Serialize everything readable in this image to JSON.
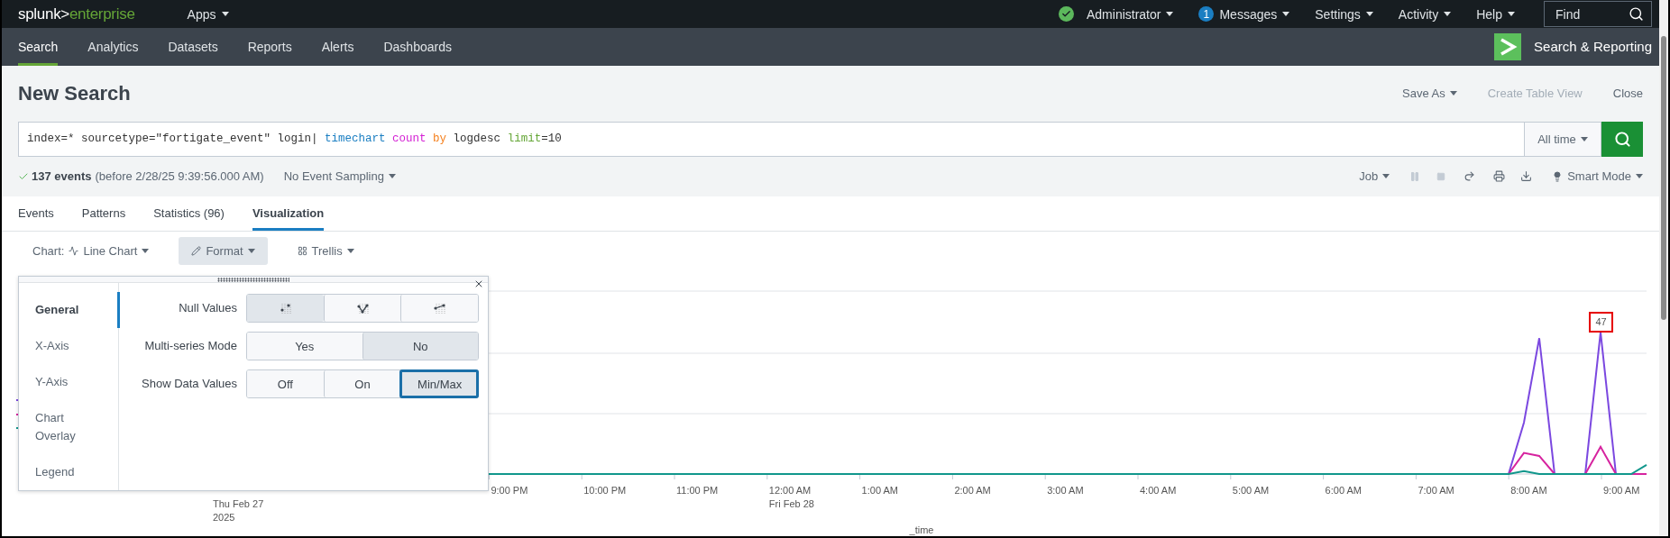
{
  "top_bar": {
    "logo_prefix": "splunk>",
    "logo_suffix": "enterprise",
    "apps_menu": "Apps",
    "user_menu": "Administrator",
    "messages": {
      "count": "1",
      "label": "Messages"
    },
    "menus": [
      "Settings",
      "Activity",
      "Help"
    ],
    "find": {
      "placeholder": "Find"
    }
  },
  "nav": {
    "tabs": [
      {
        "label": "Search",
        "selected": true
      },
      {
        "label": "Analytics",
        "selected": false
      },
      {
        "label": "Datasets",
        "selected": false
      },
      {
        "label": "Reports",
        "selected": false
      },
      {
        "label": "Alerts",
        "selected": false
      },
      {
        "label": "Dashboards",
        "selected": false
      }
    ],
    "app_title": "Search & Reporting"
  },
  "header": {
    "title": "New Search",
    "actions": [
      {
        "label": "Save As",
        "dropdown": true,
        "disabled": false
      },
      {
        "label": "Create Table View",
        "dropdown": false,
        "disabled": true
      },
      {
        "label": "Close",
        "dropdown": false,
        "disabled": false
      }
    ]
  },
  "search": {
    "query": [
      {
        "text": "index=* sourcetype=\"fortigate_event\" login| ",
        "kind": "plain"
      },
      {
        "text": "timechart ",
        "kind": "command"
      },
      {
        "text": "count ",
        "kind": "function"
      },
      {
        "text": "by",
        "kind": "keyword"
      },
      {
        "text": " logdesc ",
        "kind": "plain"
      },
      {
        "text": "limit",
        "kind": "argument"
      },
      {
        "text": "=10",
        "kind": "plain"
      }
    ],
    "time_range": "All time"
  },
  "status": {
    "count": "137 events",
    "detail": "(before 2/28/25 9:39:56.000 AM)",
    "sampling": "No Event Sampling",
    "job_menu": "Job",
    "mode": "Smart Mode"
  },
  "result_tabs": [
    {
      "label": "Events",
      "selected": false
    },
    {
      "label": "Patterns",
      "selected": false
    },
    {
      "label": "Statistics (96)",
      "selected": false
    },
    {
      "label": "Visualization",
      "selected": true
    }
  ],
  "viz_toolbar": {
    "chart_prefix": "Chart:",
    "chart_type": "Line Chart",
    "format": {
      "label": "Format",
      "active": true
    },
    "trellis": "Trellis"
  },
  "format_panel": {
    "sections": [
      {
        "label": "General",
        "selected": true
      },
      {
        "label": "X-Axis",
        "selected": false
      },
      {
        "label": "Y-Axis",
        "selected": false
      },
      {
        "label": "Chart Overlay",
        "selected": false
      },
      {
        "label": "Legend",
        "selected": false
      }
    ],
    "options": [
      {
        "label": "Null Values",
        "choices": [
          {
            "kind": "gaps",
            "selected": true,
            "focused": false
          },
          {
            "kind": "zero",
            "selected": false,
            "focused": false
          },
          {
            "kind": "connect",
            "selected": false,
            "focused": false
          }
        ]
      },
      {
        "label": "Multi-series Mode",
        "choices": [
          {
            "label": "Yes",
            "selected": false,
            "focused": false
          },
          {
            "label": "No",
            "selected": true,
            "focused": false
          }
        ]
      },
      {
        "label": "Show Data Values",
        "choices": [
          {
            "label": "Off",
            "selected": false,
            "focused": false
          },
          {
            "label": "On",
            "selected": false,
            "focused": false
          },
          {
            "label": "Min/Max",
            "selected": true,
            "focused": true
          }
        ]
      }
    ]
  },
  "chart": {
    "ticks": [
      {
        "date": "Thu Feb 27",
        "year": "2025"
      },
      {
        "time": "9:00 PM"
      },
      {
        "time": "10:00 PM"
      },
      {
        "time": "11:00 PM"
      },
      {
        "time": "12:00 AM",
        "date": "Fri Feb 28"
      },
      {
        "time": "1:00 AM"
      },
      {
        "time": "2:00 AM"
      },
      {
        "time": "3:00 AM"
      },
      {
        "time": "4:00 AM"
      },
      {
        "time": "5:00 AM"
      },
      {
        "time": "6:00 AM"
      },
      {
        "time": "7:00 AM"
      },
      {
        "time": "8:00 AM"
      },
      {
        "time": "9:00 AM"
      }
    ],
    "max_label": "47",
    "x_title": "_time"
  }
}
